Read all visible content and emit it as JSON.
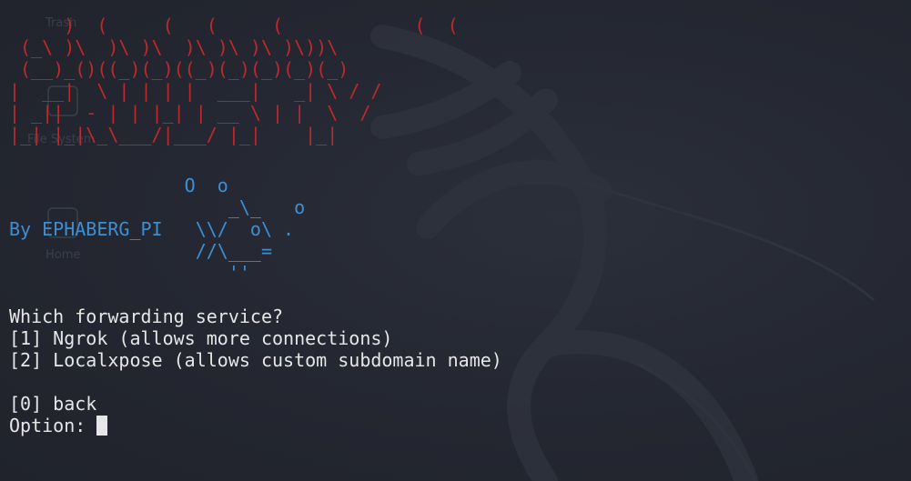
{
  "desktop": {
    "icons": [
      {
        "label": "Trash"
      },
      {
        "label": "File System"
      },
      {
        "label": "Home"
      }
    ]
  },
  "terminal": {
    "banner_lines": [
      "     )  (     (   (     (            (  (",
      " (_\\ )\\  )\\ )\\  )\\ )\\ )\\ )\\))\\",
      " (__)_()((_)(_)((_)(_)(_)(_)(_)",
      "|  __|  \\ | | | |  ___|   _| \\ / /",
      "| _||  - | | |_| | __ \\ | |  \\  /",
      "|_| |_|\\_\\___/|___/ |_|    |_|"
    ],
    "art_lines": [
      "                O  o",
      "                    _\\_   o",
      "By EPHABERG_PI   \\\\/  o\\ .",
      "                 //\\___=",
      "                    ''"
    ],
    "prompt_lines": [
      "Which forwarding service?",
      "[1] Ngrok (allows more connections)",
      "[2] Localxpose (allows custom subdomain name)",
      "",
      "[0] back"
    ],
    "input_label": "Option: ",
    "input_value": ""
  },
  "colors": {
    "background": "#23262f",
    "banner": "#c0292b",
    "accent_blue": "#3f8fd0",
    "text": "#e6e6e6"
  }
}
